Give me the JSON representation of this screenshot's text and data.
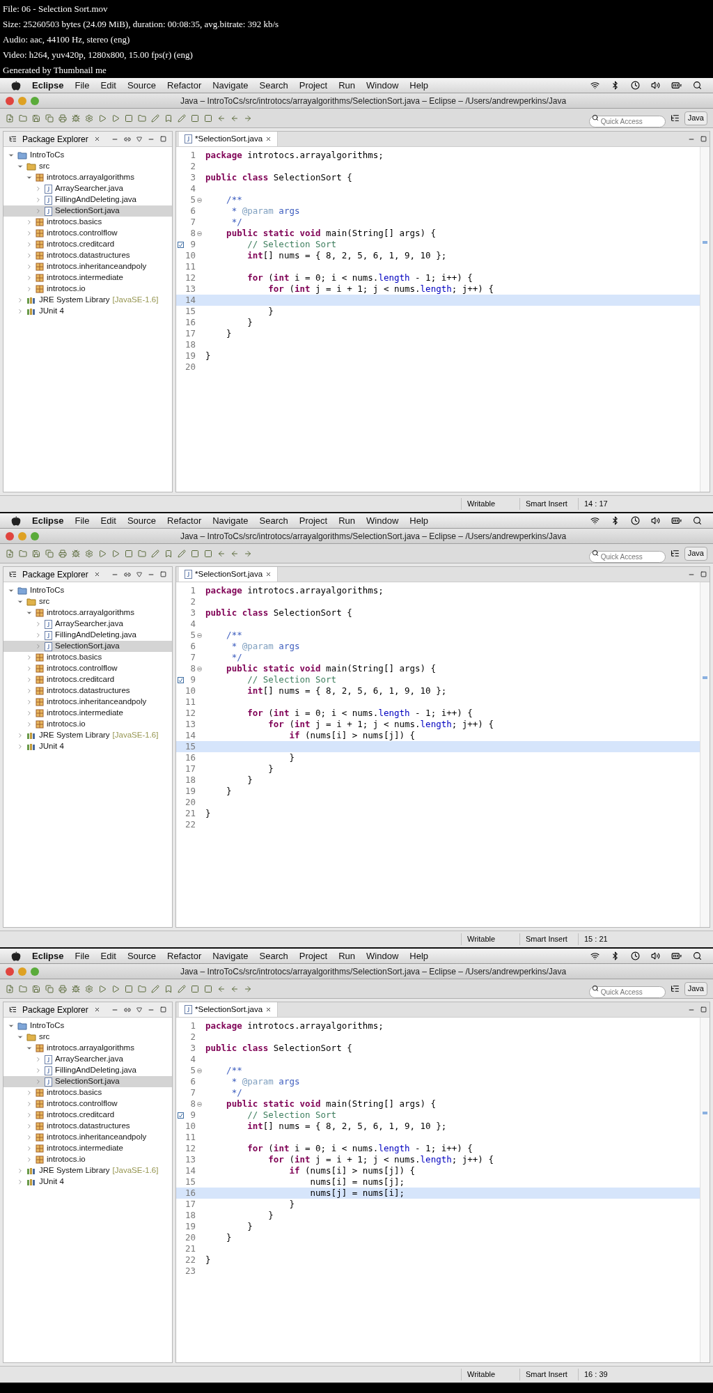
{
  "header": {
    "lines": [
      "File: 06 - Selection Sort.mov",
      "Size: 25260503 bytes (24.09 MiB), duration: 00:08:35, avg.bitrate: 392 kb/s",
      "Audio: aac, 44100 Hz, stereo (eng)",
      "Video: h264, yuv420p, 1280x800, 15.00 fps(r) (eng)",
      "Generated by Thumbnail me"
    ]
  },
  "frames": [
    {
      "menubar": {
        "items": [
          {
            "label": "Eclipse",
            "kind": "app"
          },
          {
            "label": "File",
            "kind": "menu"
          },
          {
            "label": "Edit",
            "kind": "menu"
          },
          {
            "label": "Source",
            "kind": "menu"
          },
          {
            "label": "Refactor",
            "kind": "menu"
          },
          {
            "label": "Navigate",
            "kind": "menu"
          },
          {
            "label": "Search",
            "kind": "menu"
          },
          {
            "label": "Project",
            "kind": "menu"
          },
          {
            "label": "Run",
            "kind": "menu"
          },
          {
            "label": "Window",
            "kind": "menu"
          },
          {
            "label": "Help",
            "kind": "menu"
          }
        ]
      },
      "title": "Java – IntroToCs/src/introtocs/arrayalgorithms/SelectionSort.java – Eclipse – /Users/andrewperkins/Java",
      "toolbar": {
        "quick_access": {
          "placeholder": "Quick Access"
        },
        "perspective": "Java"
      },
      "explorer": {
        "title": "Package Explorer",
        "tree": [
          {
            "label": "IntroToCs",
            "kind": "project",
            "expanded": true,
            "selected": false,
            "children": [
              {
                "label": "src",
                "kind": "folder",
                "expanded": true,
                "selected": false,
                "children": [
                  {
                    "label": "introtocs.arrayalgorithms",
                    "kind": "package",
                    "expanded": true,
                    "selected": false,
                    "children": [
                      {
                        "label": "ArraySearcher.java",
                        "kind": "file",
                        "expanded": false,
                        "selected": false
                      },
                      {
                        "label": "FillingAndDeleting.java",
                        "kind": "file",
                        "expanded": false,
                        "selected": false
                      },
                      {
                        "label": "SelectionSort.java",
                        "kind": "file",
                        "expanded": false,
                        "selected": true
                      }
                    ]
                  },
                  {
                    "label": "introtocs.basics",
                    "kind": "package",
                    "expanded": false,
                    "selected": false
                  },
                  {
                    "label": "introtocs.controlflow",
                    "kind": "package",
                    "expanded": false,
                    "selected": false
                  },
                  {
                    "label": "introtocs.creditcard",
                    "kind": "package",
                    "expanded": false,
                    "selected": false
                  },
                  {
                    "label": "introtocs.datastructures",
                    "kind": "package",
                    "expanded": false,
                    "selected": false
                  },
                  {
                    "label": "introtocs.inheritanceandpoly",
                    "kind": "package",
                    "expanded": false,
                    "selected": false
                  },
                  {
                    "label": "introtocs.intermediate",
                    "kind": "package",
                    "expanded": false,
                    "selected": false
                  },
                  {
                    "label": "introtocs.io",
                    "kind": "package",
                    "expanded": false,
                    "selected": false
                  }
                ]
              },
              {
                "label": "JRE System Library",
                "decoration": "[JavaSE-1.6]",
                "kind": "library",
                "expanded": false,
                "selected": false
              },
              {
                "label": "JUnit 4",
                "kind": "library",
                "expanded": false,
                "selected": false
              }
            ]
          }
        ]
      },
      "editor": {
        "tab": "*SelectionSort.java",
        "lines": [
          {
            "no": "1",
            "fold": false,
            "task": false,
            "current": false,
            "segments": [
              {
                "kind": "keyword",
                "text": "package"
              },
              {
                "kind": "plain",
                "text": " introtocs.arrayalgorithms;"
              }
            ]
          },
          {
            "no": "2",
            "fold": false,
            "task": false,
            "current": false
          },
          {
            "no": "3",
            "fold": false,
            "task": false,
            "current": false,
            "segments": [
              {
                "kind": "keyword",
                "text": "public class"
              },
              {
                "kind": "plain",
                "text": " SelectionSort {"
              }
            ]
          },
          {
            "no": "4",
            "fold": false,
            "task": false,
            "current": false
          },
          {
            "no": "5",
            "fold": true,
            "task": false,
            "current": false,
            "segments": [
              {
                "kind": "javadoc",
                "text": "    /**"
              }
            ]
          },
          {
            "no": "6",
            "fold": false,
            "task": false,
            "current": false,
            "segments": [
              {
                "kind": "javadoc",
                "text": "     * "
              },
              {
                "kind": "doctag",
                "text": "@param"
              },
              {
                "kind": "javadoc",
                "text": " args"
              }
            ]
          },
          {
            "no": "7",
            "fold": false,
            "task": false,
            "current": false,
            "segments": [
              {
                "kind": "javadoc",
                "text": "     */"
              }
            ]
          },
          {
            "no": "8",
            "fold": true,
            "task": false,
            "current": false,
            "segments": [
              {
                "kind": "keyword",
                "text": "    public static void"
              },
              {
                "kind": "plain",
                "text": " main(String[] args) {"
              }
            ]
          },
          {
            "no": "9",
            "fold": false,
            "task": true,
            "current": false,
            "segments": [
              {
                "kind": "comment",
                "text": "        // Selection Sort"
              }
            ]
          },
          {
            "no": "10",
            "fold": false,
            "task": false,
            "current": false,
            "segments": [
              {
                "kind": "keyword",
                "text": "        int"
              },
              {
                "kind": "plain",
                "text": "[] nums = { 8, 2, 5, 6, 1, 9, 10 };"
              }
            ]
          },
          {
            "no": "11",
            "fold": false,
            "task": false,
            "current": false
          },
          {
            "no": "12",
            "fold": false,
            "task": false,
            "current": false,
            "segments": [
              {
                "kind": "keyword",
                "text": "        for"
              },
              {
                "kind": "plain",
                "text": " ("
              },
              {
                "kind": "keyword",
                "text": "int"
              },
              {
                "kind": "plain",
                "text": " i = 0; i < nums."
              },
              {
                "kind": "field",
                "text": "length"
              },
              {
                "kind": "plain",
                "text": " - 1; i++) {"
              }
            ]
          },
          {
            "no": "13",
            "fold": false,
            "task": false,
            "current": false,
            "segments": [
              {
                "kind": "keyword",
                "text": "            for"
              },
              {
                "kind": "plain",
                "text": " ("
              },
              {
                "kind": "keyword",
                "text": "int"
              },
              {
                "kind": "plain",
                "text": " j = i + 1; j < nums."
              },
              {
                "kind": "field",
                "text": "length"
              },
              {
                "kind": "plain",
                "text": "; j++) {"
              }
            ]
          },
          {
            "no": "14",
            "fold": false,
            "task": false,
            "current": true
          },
          {
            "no": "15",
            "fold": false,
            "task": false,
            "current": false,
            "segments": [
              {
                "kind": "plain",
                "text": "            }"
              }
            ]
          },
          {
            "no": "16",
            "fold": false,
            "task": false,
            "current": false,
            "segments": [
              {
                "kind": "plain",
                "text": "        }"
              }
            ]
          },
          {
            "no": "17",
            "fold": false,
            "task": false,
            "current": false,
            "segments": [
              {
                "kind": "plain",
                "text": "    }"
              }
            ]
          },
          {
            "no": "18",
            "fold": false,
            "task": false,
            "current": false
          },
          {
            "no": "19",
            "fold": false,
            "task": false,
            "current": false,
            "segments": [
              {
                "kind": "plain",
                "text": "}"
              }
            ]
          },
          {
            "no": "20",
            "fold": false,
            "task": false,
            "current": false
          }
        ]
      },
      "status": [
        "Writable",
        "Smart Insert",
        "14 : 17"
      ]
    },
    {
      "menubar": {
        "items": [
          {
            "label": "Eclipse",
            "kind": "app"
          },
          {
            "label": "File",
            "kind": "menu"
          },
          {
            "label": "Edit",
            "kind": "menu"
          },
          {
            "label": "Source",
            "kind": "menu"
          },
          {
            "label": "Refactor",
            "kind": "menu"
          },
          {
            "label": "Navigate",
            "kind": "menu"
          },
          {
            "label": "Search",
            "kind": "menu"
          },
          {
            "label": "Project",
            "kind": "menu"
          },
          {
            "label": "Run",
            "kind": "menu"
          },
          {
            "label": "Window",
            "kind": "menu"
          },
          {
            "label": "Help",
            "kind": "menu"
          }
        ]
      },
      "title": "Java – IntroToCs/src/introtocs/arrayalgorithms/SelectionSort.java – Eclipse – /Users/andrewperkins/Java",
      "toolbar": {
        "quick_access": {
          "placeholder": "Quick Access"
        },
        "perspective": "Java"
      },
      "explorer": {
        "title": "Package Explorer",
        "tree": [
          {
            "label": "IntroToCs",
            "kind": "project",
            "expanded": true,
            "selected": false,
            "children": [
              {
                "label": "src",
                "kind": "folder",
                "expanded": true,
                "selected": false,
                "children": [
                  {
                    "label": "introtocs.arrayalgorithms",
                    "kind": "package",
                    "expanded": true,
                    "selected": false,
                    "children": [
                      {
                        "label": "ArraySearcher.java",
                        "kind": "file",
                        "expanded": false,
                        "selected": false
                      },
                      {
                        "label": "FillingAndDeleting.java",
                        "kind": "file",
                        "expanded": false,
                        "selected": false
                      },
                      {
                        "label": "SelectionSort.java",
                        "kind": "file",
                        "expanded": false,
                        "selected": true
                      }
                    ]
                  },
                  {
                    "label": "introtocs.basics",
                    "kind": "package",
                    "expanded": false,
                    "selected": false
                  },
                  {
                    "label": "introtocs.controlflow",
                    "kind": "package",
                    "expanded": false,
                    "selected": false
                  },
                  {
                    "label": "introtocs.creditcard",
                    "kind": "package",
                    "expanded": false,
                    "selected": false
                  },
                  {
                    "label": "introtocs.datastructures",
                    "kind": "package",
                    "expanded": false,
                    "selected": false
                  },
                  {
                    "label": "introtocs.inheritanceandpoly",
                    "kind": "package",
                    "expanded": false,
                    "selected": false
                  },
                  {
                    "label": "introtocs.intermediate",
                    "kind": "package",
                    "expanded": false,
                    "selected": false
                  },
                  {
                    "label": "introtocs.io",
                    "kind": "package",
                    "expanded": false,
                    "selected": false
                  }
                ]
              },
              {
                "label": "JRE System Library",
                "decoration": "[JavaSE-1.6]",
                "kind": "library",
                "expanded": false,
                "selected": false
              },
              {
                "label": "JUnit 4",
                "kind": "library",
                "expanded": false,
                "selected": false
              }
            ]
          }
        ]
      },
      "editor": {
        "tab": "*SelectionSort.java",
        "lines": [
          {
            "no": "1",
            "fold": false,
            "task": false,
            "current": false,
            "segments": [
              {
                "kind": "keyword",
                "text": "package"
              },
              {
                "kind": "plain",
                "text": " introtocs.arrayalgorithms;"
              }
            ]
          },
          {
            "no": "2",
            "fold": false,
            "task": false,
            "current": false
          },
          {
            "no": "3",
            "fold": false,
            "task": false,
            "current": false,
            "segments": [
              {
                "kind": "keyword",
                "text": "public class"
              },
              {
                "kind": "plain",
                "text": " SelectionSort {"
              }
            ]
          },
          {
            "no": "4",
            "fold": false,
            "task": false,
            "current": false
          },
          {
            "no": "5",
            "fold": true,
            "task": false,
            "current": false,
            "segments": [
              {
                "kind": "javadoc",
                "text": "    /**"
              }
            ]
          },
          {
            "no": "6",
            "fold": false,
            "task": false,
            "current": false,
            "segments": [
              {
                "kind": "javadoc",
                "text": "     * "
              },
              {
                "kind": "doctag",
                "text": "@param"
              },
              {
                "kind": "javadoc",
                "text": " args"
              }
            ]
          },
          {
            "no": "7",
            "fold": false,
            "task": false,
            "current": false,
            "segments": [
              {
                "kind": "javadoc",
                "text": "     */"
              }
            ]
          },
          {
            "no": "8",
            "fold": true,
            "task": false,
            "current": false,
            "segments": [
              {
                "kind": "keyword",
                "text": "    public static void"
              },
              {
                "kind": "plain",
                "text": " main(String[] args) {"
              }
            ]
          },
          {
            "no": "9",
            "fold": false,
            "task": true,
            "current": false,
            "segments": [
              {
                "kind": "comment",
                "text": "        // Selection Sort"
              }
            ]
          },
          {
            "no": "10",
            "fold": false,
            "task": false,
            "current": false,
            "segments": [
              {
                "kind": "keyword",
                "text": "        int"
              },
              {
                "kind": "plain",
                "text": "[] nums = { 8, 2, 5, 6, 1, 9, 10 };"
              }
            ]
          },
          {
            "no": "11",
            "fold": false,
            "task": false,
            "current": false
          },
          {
            "no": "12",
            "fold": false,
            "task": false,
            "current": false,
            "segments": [
              {
                "kind": "keyword",
                "text": "        for"
              },
              {
                "kind": "plain",
                "text": " ("
              },
              {
                "kind": "keyword",
                "text": "int"
              },
              {
                "kind": "plain",
                "text": " i = 0; i < nums."
              },
              {
                "kind": "field",
                "text": "length"
              },
              {
                "kind": "plain",
                "text": " - 1; i++) {"
              }
            ]
          },
          {
            "no": "13",
            "fold": false,
            "task": false,
            "current": false,
            "segments": [
              {
                "kind": "keyword",
                "text": "            for"
              },
              {
                "kind": "plain",
                "text": " ("
              },
              {
                "kind": "keyword",
                "text": "int"
              },
              {
                "kind": "plain",
                "text": " j = i + 1; j < nums."
              },
              {
                "kind": "field",
                "text": "length"
              },
              {
                "kind": "plain",
                "text": "; j++) {"
              }
            ]
          },
          {
            "no": "14",
            "fold": false,
            "task": false,
            "current": false,
            "segments": [
              {
                "kind": "keyword",
                "text": "                if"
              },
              {
                "kind": "plain",
                "text": " (nums[i] > nums[j]) {"
              }
            ]
          },
          {
            "no": "15",
            "fold": false,
            "task": false,
            "current": true
          },
          {
            "no": "16",
            "fold": false,
            "task": false,
            "current": false,
            "segments": [
              {
                "kind": "plain",
                "text": "                }"
              }
            ]
          },
          {
            "no": "17",
            "fold": false,
            "task": false,
            "current": false,
            "segments": [
              {
                "kind": "plain",
                "text": "            }"
              }
            ]
          },
          {
            "no": "18",
            "fold": false,
            "task": false,
            "current": false,
            "segments": [
              {
                "kind": "plain",
                "text": "        }"
              }
            ]
          },
          {
            "no": "19",
            "fold": false,
            "task": false,
            "current": false,
            "segments": [
              {
                "kind": "plain",
                "text": "    }"
              }
            ]
          },
          {
            "no": "20",
            "fold": false,
            "task": false,
            "current": false
          },
          {
            "no": "21",
            "fold": false,
            "task": false,
            "current": false,
            "segments": [
              {
                "kind": "plain",
                "text": "}"
              }
            ]
          },
          {
            "no": "22",
            "fold": false,
            "task": false,
            "current": false
          }
        ]
      },
      "status": [
        "Writable",
        "Smart Insert",
        "15 : 21"
      ]
    },
    {
      "menubar": {
        "items": [
          {
            "label": "Eclipse",
            "kind": "app"
          },
          {
            "label": "File",
            "kind": "menu"
          },
          {
            "label": "Edit",
            "kind": "menu"
          },
          {
            "label": "Source",
            "kind": "menu"
          },
          {
            "label": "Refactor",
            "kind": "menu"
          },
          {
            "label": "Navigate",
            "kind": "menu"
          },
          {
            "label": "Search",
            "kind": "menu"
          },
          {
            "label": "Project",
            "kind": "menu"
          },
          {
            "label": "Run",
            "kind": "menu"
          },
          {
            "label": "Window",
            "kind": "menu"
          },
          {
            "label": "Help",
            "kind": "menu"
          }
        ]
      },
      "title": "Java – IntroToCs/src/introtocs/arrayalgorithms/SelectionSort.java – Eclipse – /Users/andrewperkins/Java",
      "toolbar": {
        "quick_access": {
          "placeholder": "Quick Access"
        },
        "perspective": "Java"
      },
      "explorer": {
        "title": "Package Explorer",
        "tree": [
          {
            "label": "IntroToCs",
            "kind": "project",
            "expanded": true,
            "selected": false,
            "children": [
              {
                "label": "src",
                "kind": "folder",
                "expanded": true,
                "selected": false,
                "children": [
                  {
                    "label": "introtocs.arrayalgorithms",
                    "kind": "package",
                    "expanded": true,
                    "selected": false,
                    "children": [
                      {
                        "label": "ArraySearcher.java",
                        "kind": "file",
                        "expanded": false,
                        "selected": false
                      },
                      {
                        "label": "FillingAndDeleting.java",
                        "kind": "file",
                        "expanded": false,
                        "selected": false
                      },
                      {
                        "label": "SelectionSort.java",
                        "kind": "file",
                        "expanded": false,
                        "selected": true
                      }
                    ]
                  },
                  {
                    "label": "introtocs.basics",
                    "kind": "package",
                    "expanded": false,
                    "selected": false
                  },
                  {
                    "label": "introtocs.controlflow",
                    "kind": "package",
                    "expanded": false,
                    "selected": false
                  },
                  {
                    "label": "introtocs.creditcard",
                    "kind": "package",
                    "expanded": false,
                    "selected": false
                  },
                  {
                    "label": "introtocs.datastructures",
                    "kind": "package",
                    "expanded": false,
                    "selected": false
                  },
                  {
                    "label": "introtocs.inheritanceandpoly",
                    "kind": "package",
                    "expanded": false,
                    "selected": false
                  },
                  {
                    "label": "introtocs.intermediate",
                    "kind": "package",
                    "expanded": false,
                    "selected": false
                  },
                  {
                    "label": "introtocs.io",
                    "kind": "package",
                    "expanded": false,
                    "selected": false
                  }
                ]
              },
              {
                "label": "JRE System Library",
                "decoration": "[JavaSE-1.6]",
                "kind": "library",
                "expanded": false,
                "selected": false
              },
              {
                "label": "JUnit 4",
                "kind": "library",
                "expanded": false,
                "selected": false
              }
            ]
          }
        ]
      },
      "editor": {
        "tab": "*SelectionSort.java",
        "lines": [
          {
            "no": "1",
            "fold": false,
            "task": false,
            "current": false,
            "segments": [
              {
                "kind": "keyword",
                "text": "package"
              },
              {
                "kind": "plain",
                "text": " introtocs.arrayalgorithms;"
              }
            ]
          },
          {
            "no": "2",
            "fold": false,
            "task": false,
            "current": false
          },
          {
            "no": "3",
            "fold": false,
            "task": false,
            "current": false,
            "segments": [
              {
                "kind": "keyword",
                "text": "public class"
              },
              {
                "kind": "plain",
                "text": " SelectionSort {"
              }
            ]
          },
          {
            "no": "4",
            "fold": false,
            "task": false,
            "current": false
          },
          {
            "no": "5",
            "fold": true,
            "task": false,
            "current": false,
            "segments": [
              {
                "kind": "javadoc",
                "text": "    /**"
              }
            ]
          },
          {
            "no": "6",
            "fold": false,
            "task": false,
            "current": false,
            "segments": [
              {
                "kind": "javadoc",
                "text": "     * "
              },
              {
                "kind": "doctag",
                "text": "@param"
              },
              {
                "kind": "javadoc",
                "text": " args"
              }
            ]
          },
          {
            "no": "7",
            "fold": false,
            "task": false,
            "current": false,
            "segments": [
              {
                "kind": "javadoc",
                "text": "     */"
              }
            ]
          },
          {
            "no": "8",
            "fold": true,
            "task": false,
            "current": false,
            "segments": [
              {
                "kind": "keyword",
                "text": "    public static void"
              },
              {
                "kind": "plain",
                "text": " main(String[] args) {"
              }
            ]
          },
          {
            "no": "9",
            "fold": false,
            "task": true,
            "current": false,
            "segments": [
              {
                "kind": "comment",
                "text": "        // Selection Sort"
              }
            ]
          },
          {
            "no": "10",
            "fold": false,
            "task": false,
            "current": false,
            "segments": [
              {
                "kind": "keyword",
                "text": "        int"
              },
              {
                "kind": "plain",
                "text": "[] nums = { 8, 2, 5, 6, 1, 9, 10 };"
              }
            ]
          },
          {
            "no": "11",
            "fold": false,
            "task": false,
            "current": false
          },
          {
            "no": "12",
            "fold": false,
            "task": false,
            "current": false,
            "segments": [
              {
                "kind": "keyword",
                "text": "        for"
              },
              {
                "kind": "plain",
                "text": " ("
              },
              {
                "kind": "keyword",
                "text": "int"
              },
              {
                "kind": "plain",
                "text": " i = 0; i < nums."
              },
              {
                "kind": "field",
                "text": "length"
              },
              {
                "kind": "plain",
                "text": " - 1; i++) {"
              }
            ]
          },
          {
            "no": "13",
            "fold": false,
            "task": false,
            "current": false,
            "segments": [
              {
                "kind": "keyword",
                "text": "            for"
              },
              {
                "kind": "plain",
                "text": " ("
              },
              {
                "kind": "keyword",
                "text": "int"
              },
              {
                "kind": "plain",
                "text": " j = i + 1; j < nums."
              },
              {
                "kind": "field",
                "text": "length"
              },
              {
                "kind": "plain",
                "text": "; j++) {"
              }
            ]
          },
          {
            "no": "14",
            "fold": false,
            "task": false,
            "current": false,
            "segments": [
              {
                "kind": "keyword",
                "text": "                if"
              },
              {
                "kind": "plain",
                "text": " (nums[i] > nums[j]) {"
              }
            ]
          },
          {
            "no": "15",
            "fold": false,
            "task": false,
            "current": false,
            "segments": [
              {
                "kind": "plain",
                "text": "                    nums[i] = nums[j];"
              }
            ]
          },
          {
            "no": "16",
            "fold": false,
            "task": false,
            "current": true,
            "segments": [
              {
                "kind": "plain",
                "text": "                    nums[j] = nums[i];"
              }
            ]
          },
          {
            "no": "17",
            "fold": false,
            "task": false,
            "current": false,
            "segments": [
              {
                "kind": "plain",
                "text": "                }"
              }
            ]
          },
          {
            "no": "18",
            "fold": false,
            "task": false,
            "current": false,
            "segments": [
              {
                "kind": "plain",
                "text": "            }"
              }
            ]
          },
          {
            "no": "19",
            "fold": false,
            "task": false,
            "current": false,
            "segments": [
              {
                "kind": "plain",
                "text": "        }"
              }
            ]
          },
          {
            "no": "20",
            "fold": false,
            "task": false,
            "current": false,
            "segments": [
              {
                "kind": "plain",
                "text": "    }"
              }
            ]
          },
          {
            "no": "21",
            "fold": false,
            "task": false,
            "current": false
          },
          {
            "no": "22",
            "fold": false,
            "task": false,
            "current": false,
            "segments": [
              {
                "kind": "plain",
                "text": "}"
              }
            ]
          },
          {
            "no": "23",
            "fold": false,
            "task": false,
            "current": false
          }
        ]
      },
      "status": [
        "Writable",
        "Smart Insert",
        "16 : 39"
      ]
    }
  ]
}
